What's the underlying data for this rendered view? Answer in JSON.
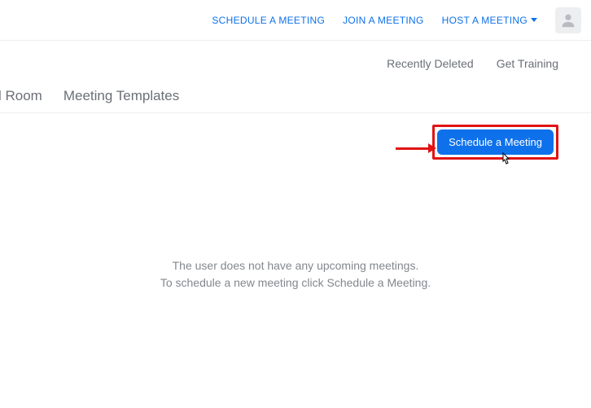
{
  "topnav": {
    "schedule": "SCHEDULE A MEETING",
    "join": "JOIN A MEETING",
    "host": "HOST A MEETING"
  },
  "subnav": {
    "recently_deleted": "Recently Deleted",
    "get_training": "Get Training"
  },
  "tabs": {
    "room_partial": "l Room",
    "templates": "Meeting Templates"
  },
  "button": {
    "schedule": "Schedule a Meeting"
  },
  "empty": {
    "line1": "The user does not have any upcoming meetings.",
    "line2": "To schedule a new meeting click Schedule a Meeting."
  }
}
